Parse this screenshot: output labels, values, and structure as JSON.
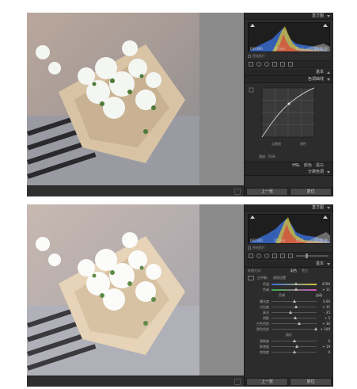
{
  "screen1": {
    "panel_header": "直方图",
    "histogram": {
      "exif_left": "ISO 800",
      "exif_mid1": "35 mm",
      "exif_mid2": "f/1.4",
      "exif_right": "1/250 秒"
    },
    "original_photo": "原始照片",
    "basic_header": "基本",
    "tone_curve_header": "色调曲线",
    "curve_labels": {
      "left": "点曲线",
      "right": "线性"
    },
    "channel_label": "通道：RGB",
    "hsl_tabs": [
      "HSL",
      "颜色",
      "黑白"
    ],
    "split_toning": "分离色调",
    "buttons": {
      "previous": "上一张",
      "reset": "复位"
    }
  },
  "screen2": {
    "panel_header": "直方图",
    "histogram": {
      "exif_left": "ISO 800",
      "exif_mid1": "35 mm",
      "exif_mid2": "f/1.4",
      "exif_right": "1/250 秒"
    },
    "original_photo": "原始照片",
    "basic_header": "基本",
    "treatment": {
      "label": "处理方式：",
      "color": "彩色",
      "bw": "黑白"
    },
    "wb": {
      "label": "白平衡：",
      "value": "原照设置"
    },
    "sliders": [
      {
        "label": "色温",
        "value": "4700",
        "pos": 0.55
      },
      {
        "label": "色调",
        "value": "+ 11",
        "pos": 0.55
      },
      {
        "label": "曝光度",
        "value": "0.00",
        "pos": 0.5
      },
      {
        "label": "对比度",
        "value": "+ 12",
        "pos": 0.54
      },
      {
        "label": "高光",
        "value": "- 35",
        "pos": 0.42
      },
      {
        "label": "阴影",
        "value": "+ 5",
        "pos": 0.52
      },
      {
        "label": "白色色阶",
        "value": "+ 36",
        "pos": 0.62
      },
      {
        "label": "黑色色阶",
        "value": "+ 100",
        "pos": 0.98
      },
      {
        "label": "清晰度",
        "value": "0",
        "pos": 0.5
      },
      {
        "label": "鲜艳度",
        "value": "+ 19",
        "pos": 0.56
      },
      {
        "label": "饱和度",
        "value": "0",
        "pos": 0.5
      }
    ],
    "tone_title": "色调",
    "auto_label": "自动",
    "presence_title": "偏好",
    "buttons": {
      "previous": "上一张",
      "reset": "复位"
    }
  },
  "colors": {
    "panel": "#2c2c2c",
    "canvas": "#6c6c6c",
    "histo_blue": "#3a6fd8",
    "histo_yellow": "#d8c23a",
    "histo_red": "#d84a3a"
  }
}
